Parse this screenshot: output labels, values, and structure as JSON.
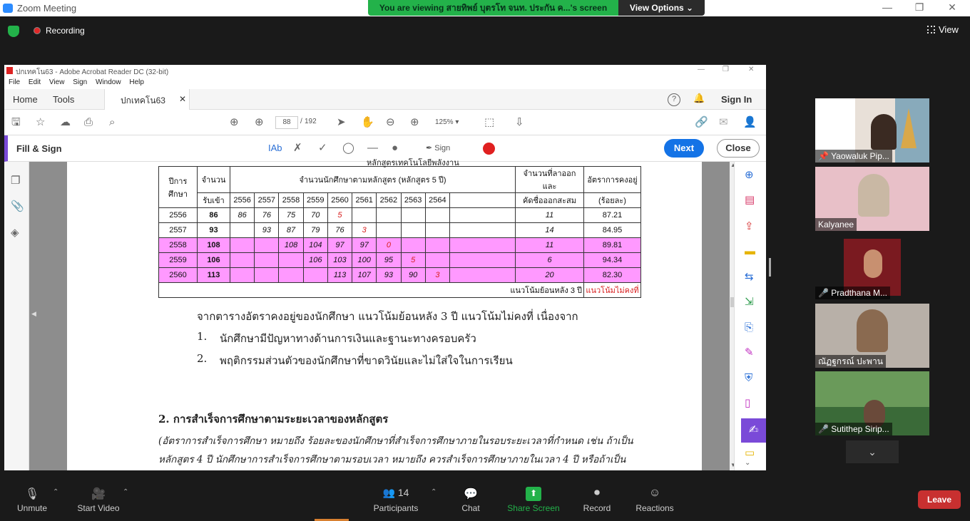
{
  "zoom": {
    "app_title": "Zoom Meeting",
    "share_banner": "You are viewing สายทิพย์ บุตรโท จนท. ประกัน ค...'s screen",
    "view_options": "View Options ⌄",
    "recording": "Recording",
    "view": "View"
  },
  "acrobat": {
    "title": "ปกเทคโน63 - Adobe Acrobat Reader DC (32-bit)",
    "menu": [
      "File",
      "Edit",
      "View",
      "Sign",
      "Window",
      "Help"
    ],
    "tabs": {
      "home": "Home",
      "tools": "Tools",
      "doc": "ปกเทคโน63",
      "help": "?",
      "signin": "Sign In"
    },
    "toolbar": {
      "page_current": "88",
      "page_sep": "/",
      "page_total": "192",
      "zoom": "125%"
    },
    "fillsign": {
      "title": "Fill & Sign",
      "sign": "Sign",
      "next": "Next",
      "close": "Close"
    }
  },
  "document": {
    "table_caption": "หลักสูตรเทคโนโลยีพลังงาน",
    "headers": {
      "year": "ปีการศึกษา",
      "intake1": "จำนวน",
      "intake2": "รับเข้า",
      "current": "จำนวนนักศึกษาตามหลักสูตร (หลักสูตร 5 ปี)",
      "dropout1": "จำนวนที่ลาออกและ",
      "dropout2": "คัดชื่อออกสะสม",
      "retention1": "อัตราการคงอยู่",
      "retention2": "(ร้อยละ)",
      "cols": [
        "2556",
        "2557",
        "2558",
        "2559",
        "2560",
        "2561",
        "2562",
        "2563",
        "2564",
        ""
      ]
    },
    "rows": [
      {
        "year": "2556",
        "intake": "86",
        "vals": [
          "86",
          "76",
          "75",
          "70",
          "5",
          "",
          "",
          "",
          "",
          ""
        ],
        "dropout": "11",
        "retention": "87.21",
        "pink": false
      },
      {
        "year": "2557",
        "intake": "93",
        "vals": [
          "",
          "93",
          "87",
          "79",
          "76",
          "3",
          "",
          "",
          "",
          ""
        ],
        "dropout": "14",
        "retention": "84.95",
        "pink": false
      },
      {
        "year": "2558",
        "intake": "108",
        "vals": [
          "",
          "",
          "108",
          "104",
          "97",
          "97",
          "0",
          "",
          "",
          ""
        ],
        "dropout": "11",
        "retention": "89.81",
        "pink": true
      },
      {
        "year": "2559",
        "intake": "106",
        "vals": [
          "",
          "",
          "",
          "106",
          "103",
          "100",
          "95",
          "5",
          "",
          ""
        ],
        "dropout": "6",
        "retention": "94.34",
        "pink": true
      },
      {
        "year": "2560",
        "intake": "113",
        "vals": [
          "",
          "",
          "",
          "",
          "113",
          "107",
          "93",
          "90",
          "3",
          ""
        ],
        "dropout": "20",
        "retention": "82.30",
        "pink": true
      }
    ],
    "footer_left": "แนวโน้มย้อนหลัง 3 ปี",
    "footer_right": "แนวโน้มไม่คงที่",
    "para1": "จากตารางอัตราคงอยู่ของนักศึกษา แนวโน้มย้อนหลัง 3 ปี แนวโน้มไม่คงที่ เนื่องจาก",
    "item1_num": "1.",
    "item1": "นักศึกษามีปัญหาทางด้านการเงินและฐานะทางครอบครัว",
    "item2_num": "2.",
    "item2": "พฤติกรรมส่วนตัวของนักศึกษาที่ขาดวินัยและไม่ใส่ใจในการเรียน",
    "section": "2.  การสำเร็จการศึกษาตามระยะเวลาของหลักสูตร",
    "italic1": "(อัตราการสำเร็จการศึกษา หมายถึง ร้อยละของนักศึกษาที่สำเร็จการศึกษาภายในรอบระยะเวลาที่กำหนด เช่น ถ้าเป็น",
    "italic2": "หลักสูตร 4 ปี นักศึกษาการสำเร็จการศึกษาตามรอบเวลา หมายถึง ควรสำเร็จการศึกษาภายในเวลา  4 ปี  หรือถ้าเป็น"
  },
  "participants": [
    {
      "name": "Yaowaluk Pip..."
    },
    {
      "name": "Kalyanee"
    },
    {
      "name": "Pradthana M..."
    },
    {
      "name": "ณัฏฐกรณ์ ปะพาน"
    },
    {
      "name": "Sutithep Sirip..."
    }
  ],
  "bottom": {
    "unmute": "Unmute",
    "start_video": "Start Video",
    "participants": "Participants",
    "participants_count": "14",
    "chat": "Chat",
    "share": "Share Screen",
    "record": "Record",
    "reactions": "Reactions",
    "leave": "Leave"
  },
  "colors": {
    "share_green": "#23b24a",
    "acrobat_blue": "#1473e6",
    "pink_row": "#ff99ff",
    "leave_red": "#c83030"
  }
}
